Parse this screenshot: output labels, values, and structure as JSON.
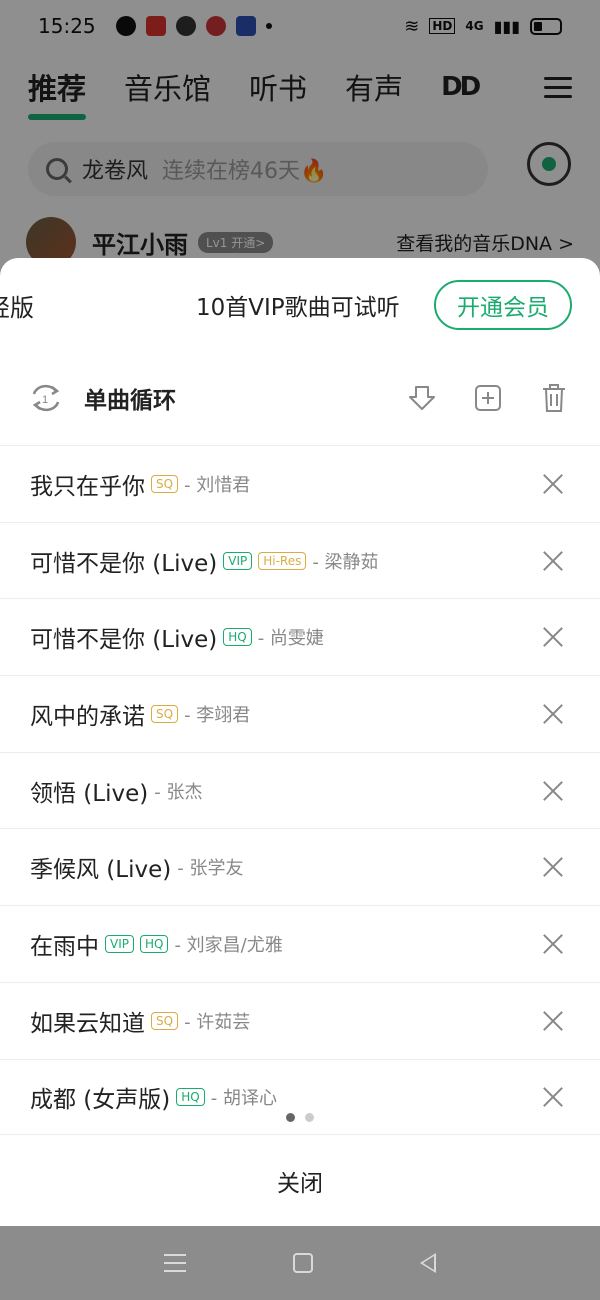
{
  "status_bar": {
    "time": "15:25",
    "network": "HD",
    "signal": "4G"
  },
  "top_tabs": [
    {
      "label": "推荐",
      "active": true
    },
    {
      "label": "音乐馆",
      "active": false
    },
    {
      "label": "听书",
      "active": false
    },
    {
      "label": "有声",
      "active": false
    }
  ],
  "dolby_label": "DD",
  "search": {
    "keyword": "龙卷风",
    "hint": "连续在榜46天🔥"
  },
  "user": {
    "name": "平江小雨",
    "badge": "Lv1 开通>",
    "dna_link": "查看我的音乐DNA >"
  },
  "sheet": {
    "promo_prev": "轻版",
    "promo_text": "10首VIP歌曲可试听",
    "vip_button": "开通会员",
    "play_mode": "单曲循环",
    "close_label": "关闭",
    "songs": [
      {
        "title": "我只在乎你",
        "tags": [
          "SQ"
        ],
        "artist": "- 刘惜君"
      },
      {
        "title": "可惜不是你 (Live)",
        "tags": [
          "VIP",
          "Hi-Res"
        ],
        "artist": "- 梁静茹"
      },
      {
        "title": "可惜不是你 (Live)",
        "tags": [
          "HQ"
        ],
        "artist": "- 尚雯婕"
      },
      {
        "title": "风中的承诺",
        "tags": [
          "SQ"
        ],
        "artist": "- 李翊君"
      },
      {
        "title": "领悟 (Live)",
        "tags": [],
        "artist": "- 张杰"
      },
      {
        "title": "季候风 (Live)",
        "tags": [],
        "artist": "- 张学友"
      },
      {
        "title": "在雨中",
        "tags": [
          "VIP",
          "HQ"
        ],
        "artist": "- 刘家昌/尤雅"
      },
      {
        "title": "如果云知道",
        "tags": [
          "SQ"
        ],
        "artist": "- 许茹芸"
      },
      {
        "title": "成都 (女声版)",
        "tags": [
          "HQ"
        ],
        "artist": "- 胡译心"
      }
    ],
    "pager": {
      "total": 2,
      "active": 0
    }
  },
  "colors": {
    "accent": "#1aab6f",
    "sq_tag": "#d8ad45"
  }
}
